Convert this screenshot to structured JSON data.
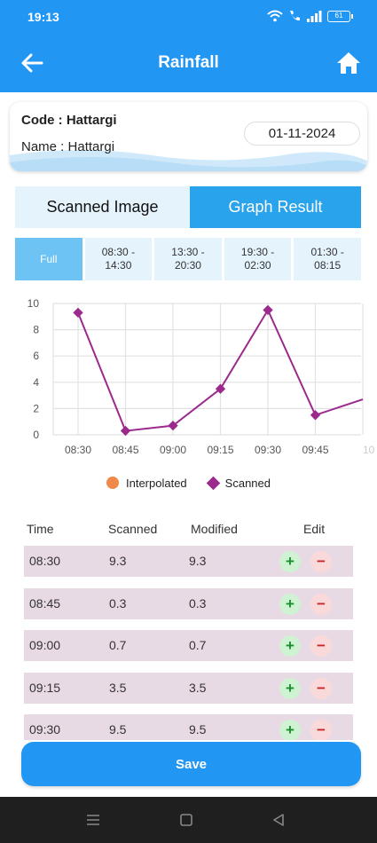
{
  "status_bar": {
    "time": "19:13",
    "battery": "61"
  },
  "header": {
    "title": "Rainfall"
  },
  "info": {
    "code_label": "Code :",
    "code_value": "Hattargi",
    "name_label": "Name :",
    "name_value": "Hattargi",
    "date": "01-11-2024"
  },
  "tabs": [
    {
      "label": "Scanned Image",
      "active": false
    },
    {
      "label": "Graph Result",
      "active": true
    }
  ],
  "ranges": [
    {
      "label": "Full",
      "active": true
    },
    {
      "label": "08:30 -\n14:30",
      "active": false
    },
    {
      "label": "13:30 -\n20:30",
      "active": false
    },
    {
      "label": "19:30 -\n02:30",
      "active": false
    },
    {
      "label": "01:30 -\n08:15",
      "active": false
    }
  ],
  "chart_data": {
    "type": "line",
    "x": [
      "08:30",
      "08:45",
      "09:00",
      "09:15",
      "09:30",
      "09:45",
      "10"
    ],
    "series": [
      {
        "name": "Interpolated",
        "color": "#F08A4B",
        "values": []
      },
      {
        "name": "Scanned",
        "color": "#9C2A8C",
        "values": [
          9.3,
          0.3,
          0.7,
          3.5,
          9.5,
          1.5,
          2.7
        ]
      }
    ],
    "ylim": [
      0,
      10
    ],
    "yticks": [
      "0",
      "2",
      "4",
      "6",
      "8",
      "10"
    ],
    "grid": true,
    "legend": "bottom"
  },
  "table": {
    "headers": {
      "time": "Time",
      "scanned": "Scanned",
      "modified": "Modified",
      "edit": "Edit"
    },
    "plus_symbol": "+",
    "minus_symbol": "−",
    "rows": [
      {
        "time": "08:30",
        "scanned": "9.3",
        "modified": "9.3"
      },
      {
        "time": "08:45",
        "scanned": "0.3",
        "modified": "0.3"
      },
      {
        "time": "09:00",
        "scanned": "0.7",
        "modified": "0.7"
      },
      {
        "time": "09:15",
        "scanned": "3.5",
        "modified": "3.5"
      },
      {
        "time": "09:30",
        "scanned": "9.5",
        "modified": "9.5"
      }
    ]
  },
  "save_label": "Save",
  "colors": {
    "primary": "#2196F3",
    "tab_active": "#29A3EC",
    "chip_active": "#6CC3F4",
    "row_bg": "#E8DAE4"
  },
  "icons": {
    "back": "arrow-left-icon",
    "home": "home-icon",
    "wifi": "wifi-icon",
    "call": "wifi-calling-icon",
    "signal": "signal-icon",
    "battery": "battery-icon",
    "nav_menu": "menu-icon",
    "nav_home": "square-icon",
    "nav_back": "triangle-back-icon"
  }
}
